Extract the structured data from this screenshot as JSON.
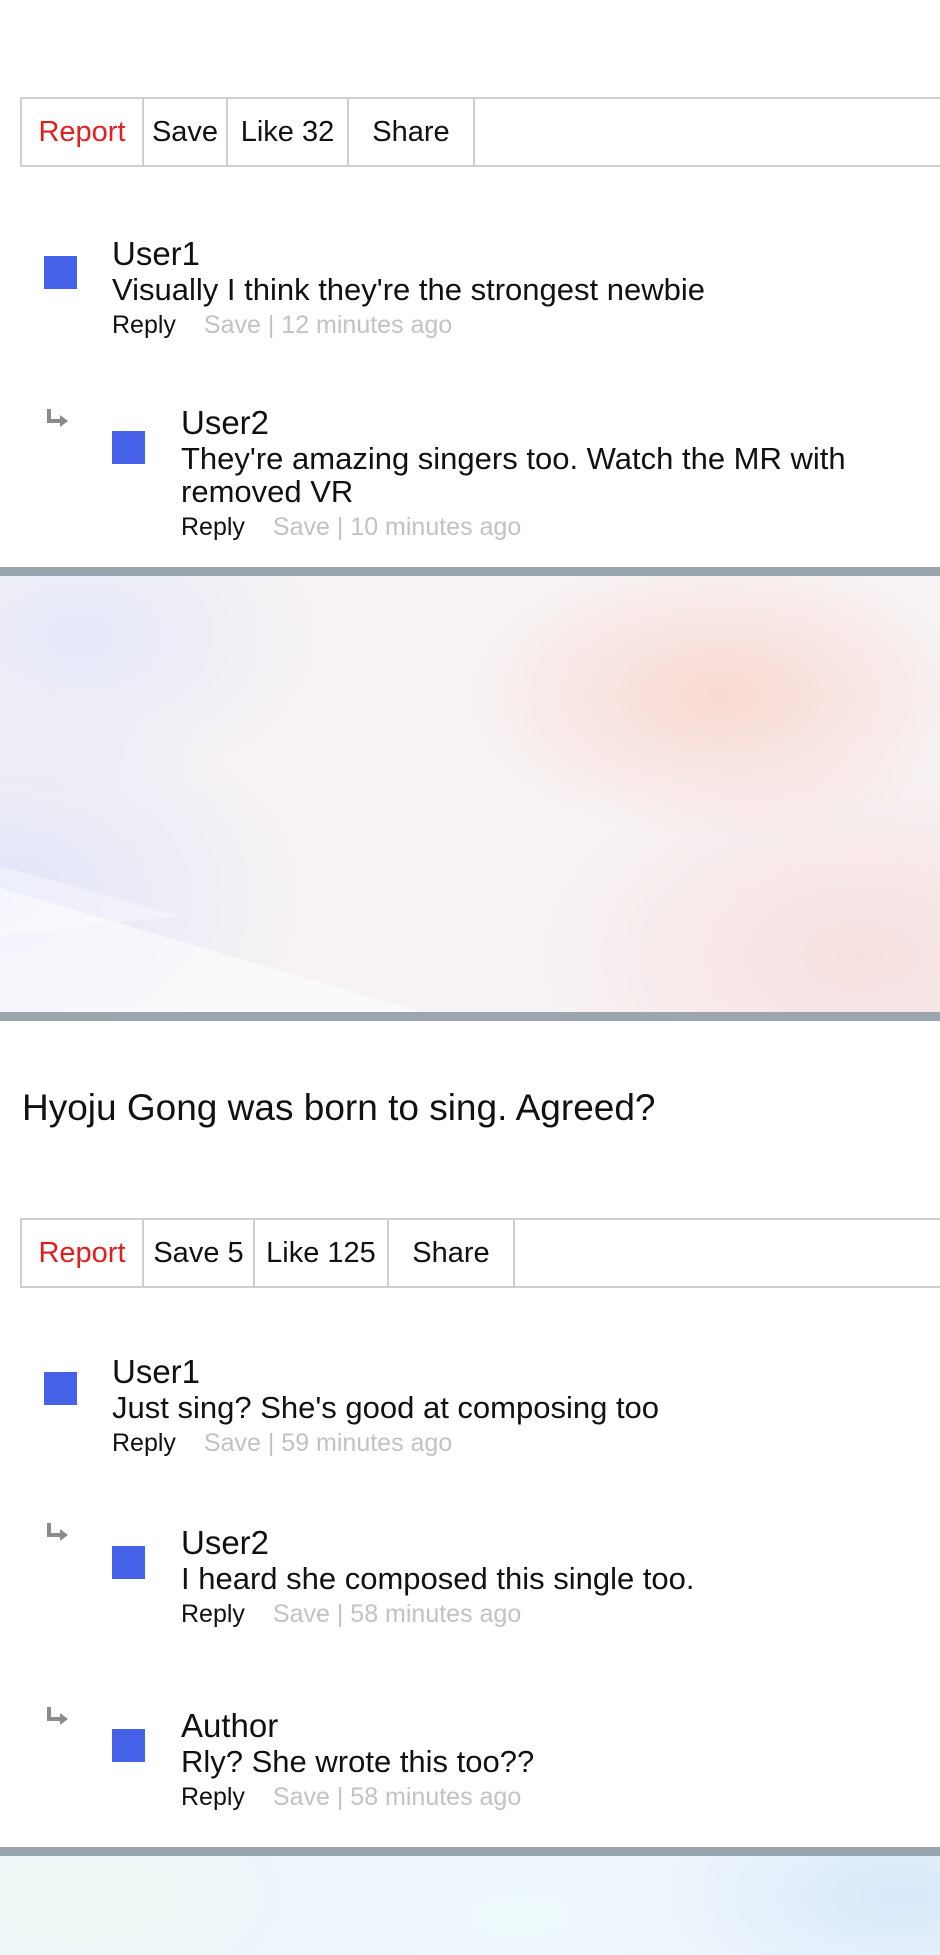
{
  "bar1": {
    "report": "Report",
    "save": "Save",
    "like": "Like 32",
    "share": "Share"
  },
  "thread1": {
    "c1": {
      "user": "User1",
      "text": "Visually I think they're the strongest newbie",
      "reply": "Reply",
      "info": "Save | 12 minutes ago"
    },
    "c2": {
      "user": "User2",
      "text": "They're amazing singers too. Watch the MR with removed VR",
      "reply": "Reply",
      "info": "Save | 10 minutes ago"
    }
  },
  "post": {
    "text": "Hyoju Gong was born to sing. Agreed?"
  },
  "bar2": {
    "report": "Report",
    "save": "Save 5",
    "like": "Like 125",
    "share": "Share"
  },
  "thread2": {
    "c1": {
      "user": "User1",
      "text": "Just sing? She's good at composing too",
      "reply": "Reply",
      "info": "Save | 59 minutes ago"
    },
    "c2": {
      "user": "User2",
      "text": "I heard she composed this single too.",
      "reply": "Reply",
      "info": "Save | 58 minutes ago"
    },
    "c3": {
      "user": "Author",
      "text": "Rly? She wrote this too??",
      "reply": "Reply",
      "info": "Save | 58 minutes ago"
    }
  },
  "colors": {
    "avatar": "#4561e8",
    "report": "#e0201f",
    "meta_info": "#c2c2c2",
    "divider": "#9aa5ad",
    "border": "#cfcfcf"
  },
  "icons": {
    "reply_indent": "reply-arrow-icon",
    "avatar": "avatar-square"
  }
}
